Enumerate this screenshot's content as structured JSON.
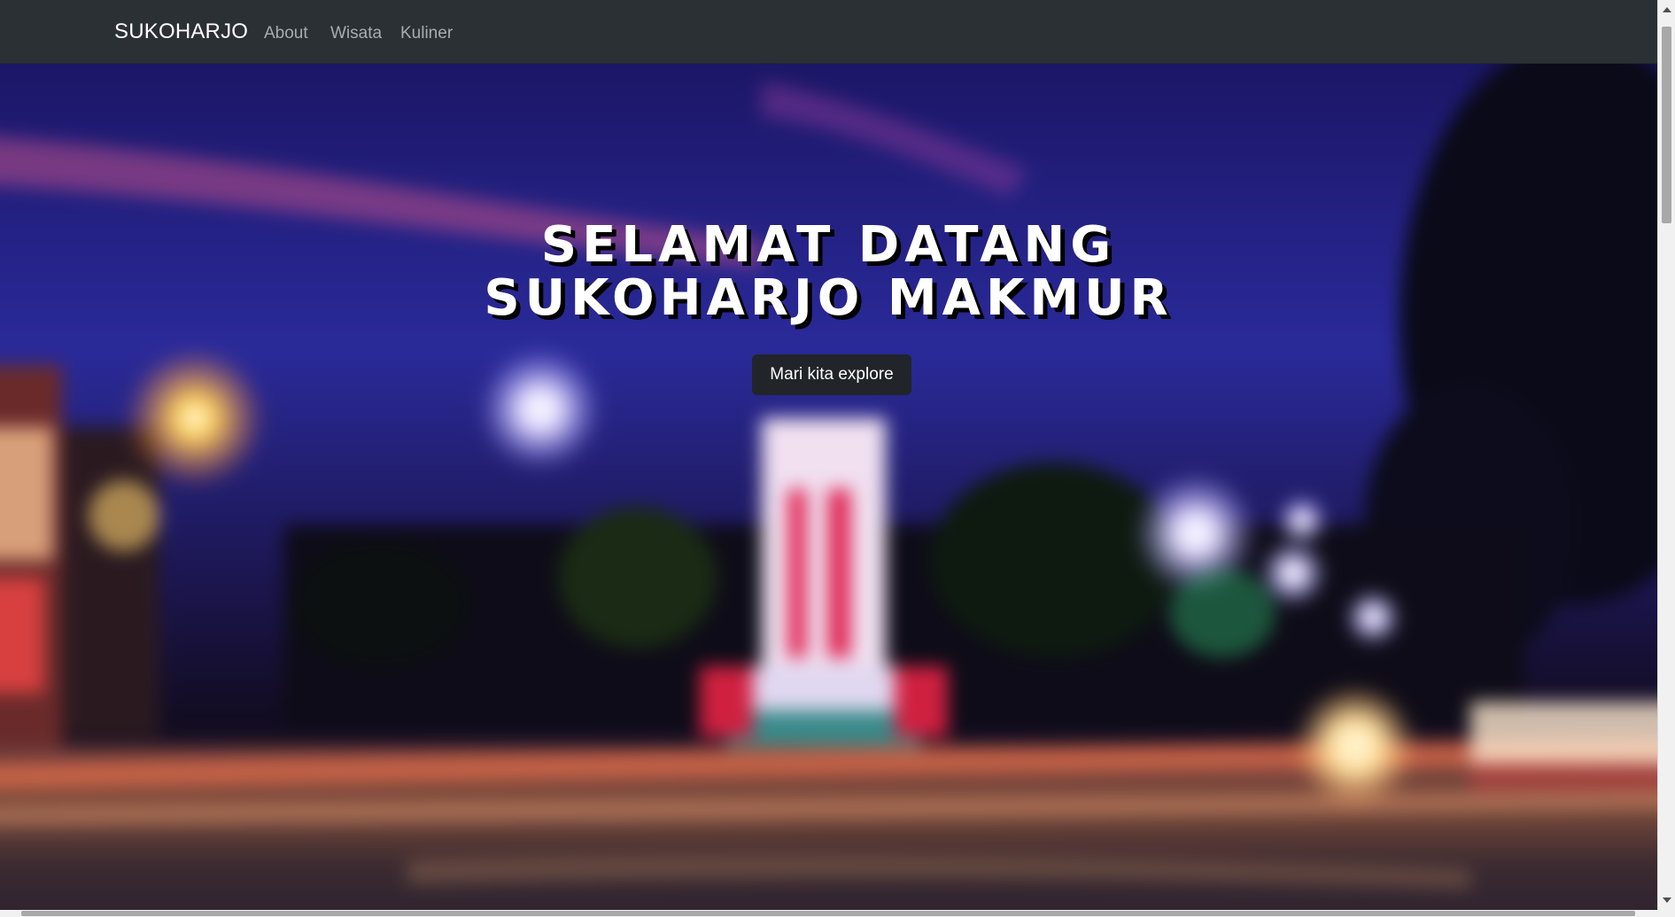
{
  "navbar": {
    "brand": "SUKOHARJO",
    "links": [
      {
        "label": "About"
      },
      {
        "label": "Wisata"
      },
      {
        "label": "Kuliner"
      }
    ]
  },
  "hero": {
    "title_line1": "SELAMAT DATANG",
    "title_line2": "SUKOHARJO MAKMUR",
    "button_label": "Mari kita explore",
    "background_icon": "blurred-night-city-photo"
  },
  "colors": {
    "navbar_bg": "#2b3035",
    "brand_text": "#ffffff",
    "nav_link": "#a7acb1",
    "button_bg": "#212529",
    "button_text": "#ffffff"
  }
}
